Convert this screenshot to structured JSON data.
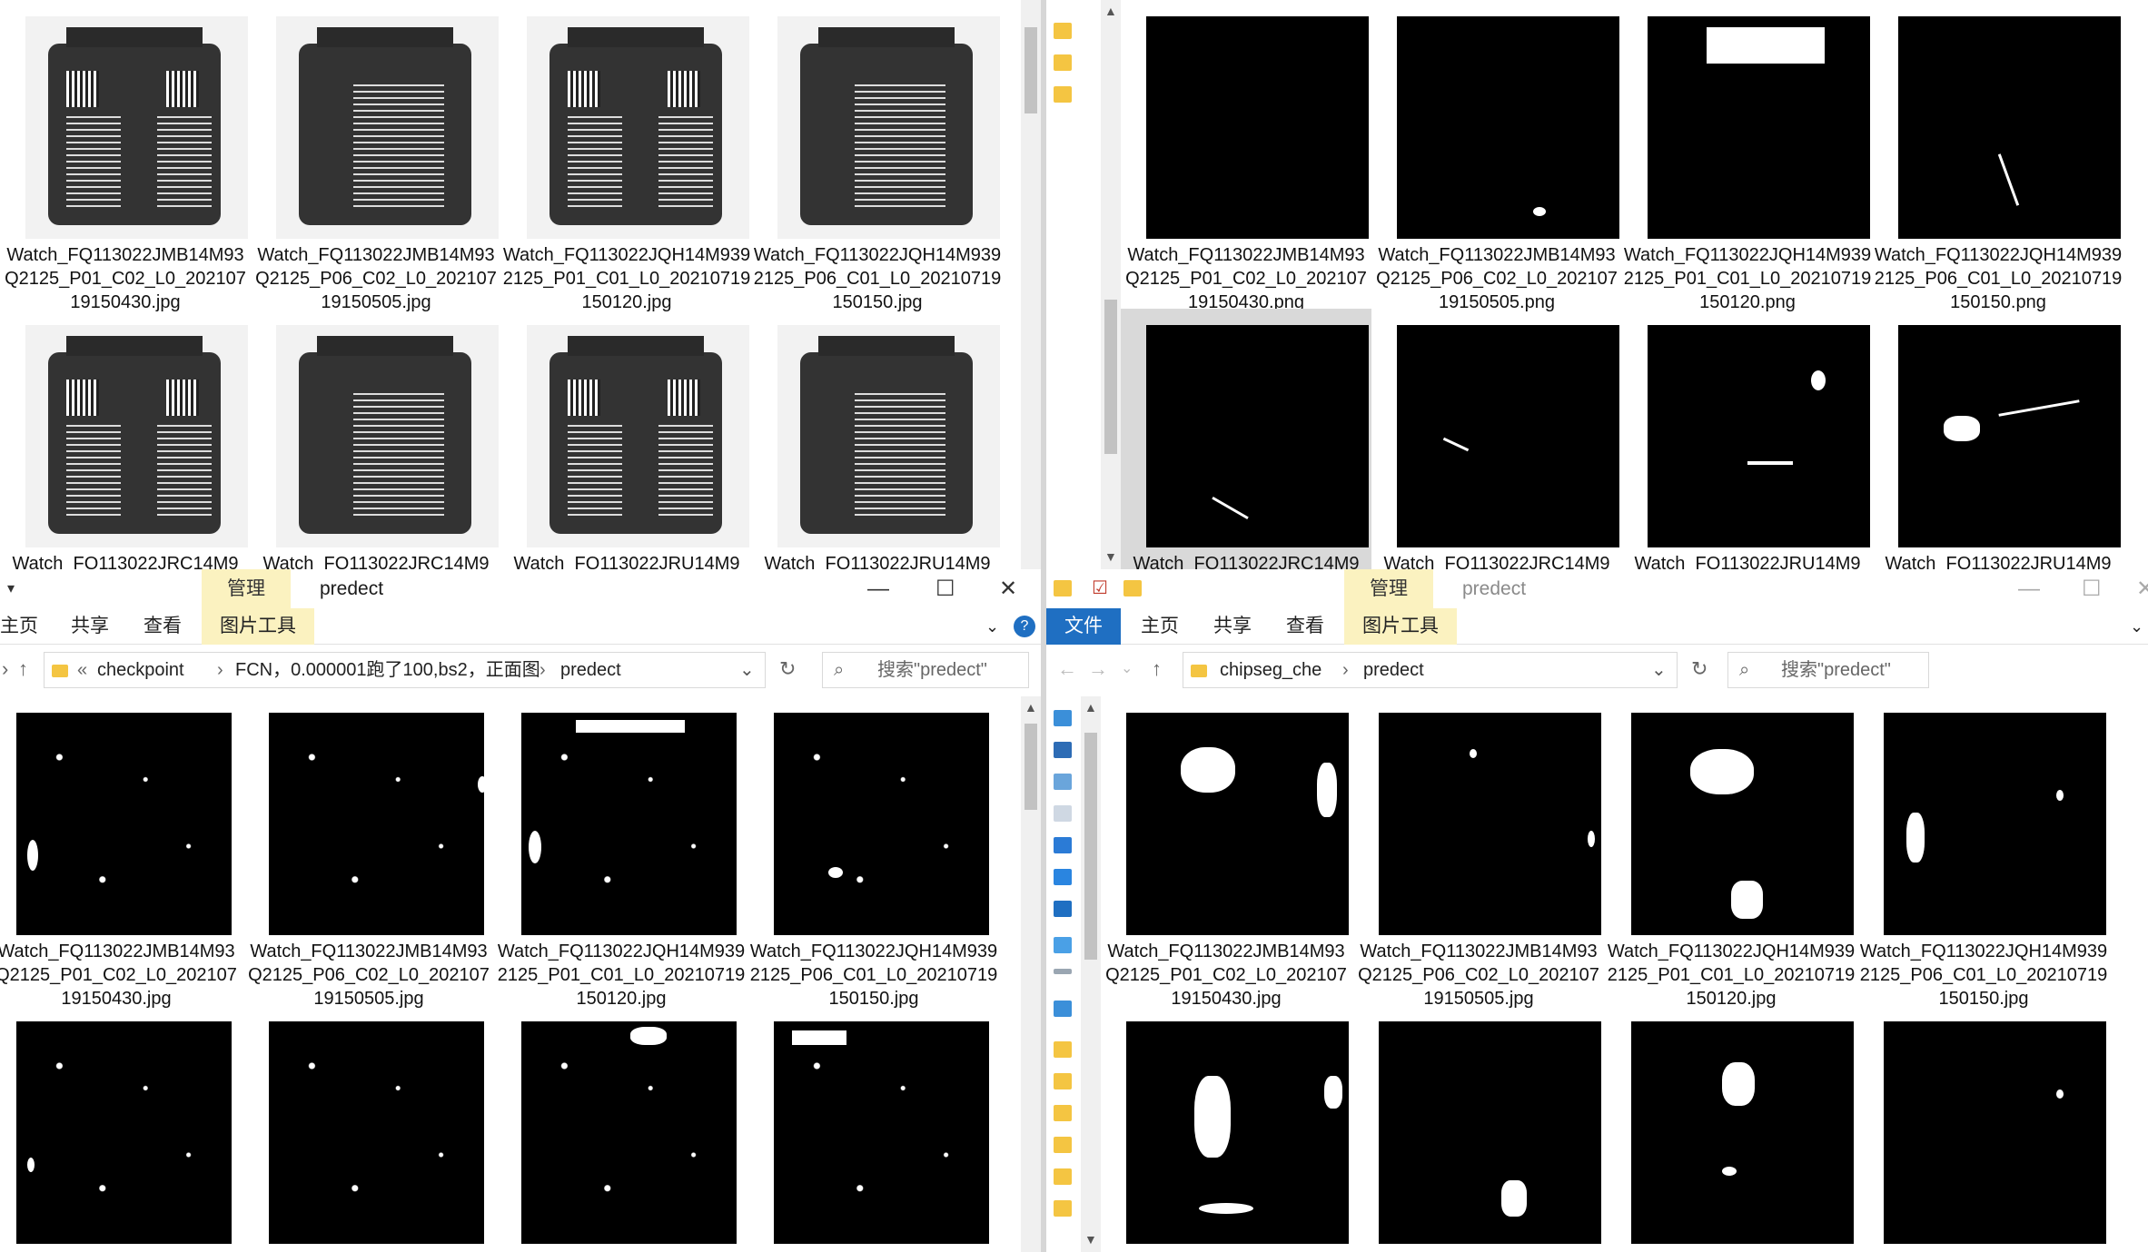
{
  "top_left": {
    "captions": [
      "Watch_FQ113022JMB14M93Q2125_P01_C02_L0_20210719150430.jpg",
      "Watch_FQ113022JMB14M93Q2125_P06_C02_L0_20210719150505.jpg",
      "Watch_FQ113022JQH14M9392125_P01_C01_L0_20210719150120.jpg",
      "Watch_FQ113022JQH14M9392125_P06_C01_L0_20210719150150.jpg"
    ],
    "partial_captions": [
      "Watch_FQ113022JRC14M9",
      "Watch_FQ113022JRC14M9",
      "Watch_FQ113022JRU14M9",
      "Watch_FQ113022JRU14M9"
    ]
  },
  "top_right": {
    "captions": [
      "Watch_FQ113022JMB14M93Q2125_P01_C02_L0_20210719150430.png",
      "Watch_FQ113022JMB14M93Q2125_P06_C02_L0_20210719150505.png",
      "Watch_FQ113022JQH14M9392125_P01_C01_L0_20210719150120.png",
      "Watch_FQ113022JQH14M9392125_P06_C01_L0_20210719150150.png"
    ],
    "partial_captions": [
      "Watch_FQ113022JRC14M9",
      "Watch_FQ113022JRC14M9",
      "Watch_FQ113022JRU14M9",
      "Watch_FQ113022JRU14M9"
    ]
  },
  "bottom_left": {
    "ribbon": {
      "manage_tab": "管理",
      "title": "predect",
      "picture_tools": "图片工具"
    },
    "menu": [
      "主页",
      "共享",
      "查看"
    ],
    "window_buttons": {
      "minimize": "—",
      "maximize": "☐",
      "close": "✕"
    },
    "breadcrumb": [
      "«",
      "checkpoint",
      "›",
      "FCN，0.000001跑了100,bs2，正面图",
      "›",
      "predect"
    ],
    "search_placeholder": "搜索\"predect\"",
    "captions": [
      "Watch_FQ113022JMB14M93Q2125_P01_C02_L0_20210719150430.jpg",
      "Watch_FQ113022JMB14M93Q2125_P06_C02_L0_20210719150505.jpg",
      "Watch_FQ113022JQH14M9392125_P01_C01_L0_20210719150120.jpg",
      "Watch_FQ113022JQH14M9392125_P06_C01_L0_20210719150150.jpg"
    ]
  },
  "bottom_right": {
    "ribbon": {
      "manage_tab": "管理",
      "title": "predect",
      "picture_tools": "图片工具"
    },
    "menu": [
      "文件",
      "主页",
      "共享",
      "查看"
    ],
    "breadcrumb": [
      "chipseg_che",
      "›",
      "predect"
    ],
    "search_placeholder": "搜索\"predect\"",
    "captions": [
      "Watch_FQ113022JMB14M93Q2125_P01_C02_L0_20210719150430.jpg",
      "Watch_FQ113022JMB14M93Q2125_P06_C02_L0_20210719150505.jpg",
      "Watch_FQ113022JQH14M9392125_P01_C01_L0_20210719150120.jpg",
      "Watch_FQ113022JQH14M9392125_P06_C01_L0_20210719150150.jpg"
    ]
  }
}
